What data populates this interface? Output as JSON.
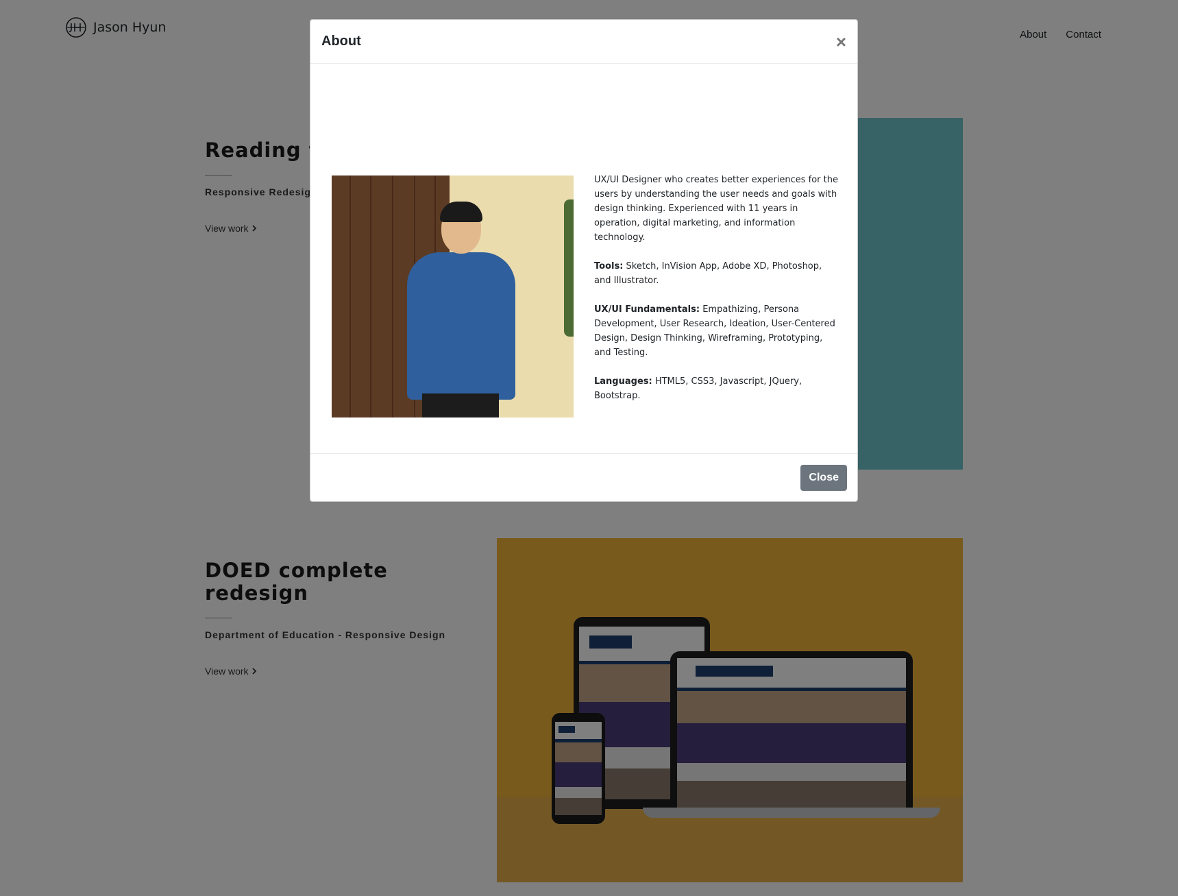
{
  "header": {
    "logo_icon": "jh-monogram-icon",
    "brand_name": "Jason Hyun",
    "nav": [
      "About",
      "Contact"
    ]
  },
  "projects": [
    {
      "title": "Reading to Non-Profit",
      "subtitle": "Responsive Redesign",
      "link": "View work",
      "link_icon": "chevron-right-icon",
      "panel_color": "#6fc5cc"
    },
    {
      "title": "DOED complete redesign",
      "subtitle": "Department of Education - Responsive Design",
      "link": "View work",
      "link_icon": "chevron-right-icon",
      "panel_color": "#f2b43a"
    }
  ],
  "modal": {
    "title": "About",
    "close_icon": "close-icon",
    "photo_alt": "Portrait of Jason Hyun in a denim shirt",
    "bio": "UX/UI Designer who creates better experiences for the users by understanding the user needs and goals with design thinking. Experienced with 11 years in operation, digital marketing, and information technology.",
    "tools_label": "Tools:",
    "tools": "Sketch, InVision App, Adobe XD, Photoshop, and Illustrator.",
    "fundamentals_label": "UX/UI Fundamentals:",
    "fundamentals": "Empathizing, Persona Development, User Research, Ideation, User-Centered Design, Design Thinking, Wireframing, Prototyping, and Testing.",
    "languages_label": "Languages:",
    "languages": "HTML5, CSS3, Javascript, JQuery, Bootstrap.",
    "close_button": "Close",
    "button_color": "#6c757d"
  }
}
